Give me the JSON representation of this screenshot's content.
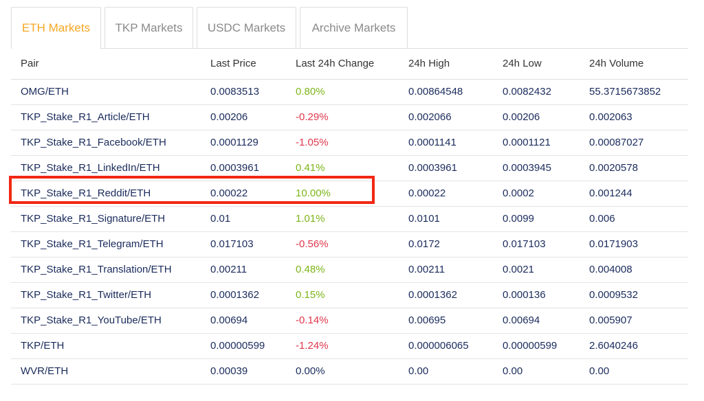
{
  "tabs": [
    {
      "label": "ETH Markets",
      "active": true,
      "width": 131
    },
    {
      "label": "TKP Markets",
      "active": false,
      "width": 129
    },
    {
      "label": "USDC Markets",
      "active": false,
      "width": 145
    },
    {
      "label": "Archive Markets",
      "active": false,
      "width": 157
    }
  ],
  "table": {
    "headers": [
      "Pair",
      "Last Price",
      "Last 24h Change",
      "24h High",
      "24h Low",
      "24h Volume"
    ],
    "rows": [
      {
        "pair": "OMG/ETH",
        "last_price": "0.0083513",
        "change": "0.80%",
        "dir": "pos",
        "high": "0.00864548",
        "low": "0.0082432",
        "volume": "55.3715673852"
      },
      {
        "pair": "TKP_Stake_R1_Article/ETH",
        "last_price": "0.00206",
        "change": "-0.29%",
        "dir": "neg",
        "high": "0.002066",
        "low": "0.00206",
        "volume": "0.002063"
      },
      {
        "pair": "TKP_Stake_R1_Facebook/ETH",
        "last_price": "0.0001129",
        "change": "-1.05%",
        "dir": "neg",
        "high": "0.0001141",
        "low": "0.0001121",
        "volume": "0.00087027"
      },
      {
        "pair": "TKP_Stake_R1_LinkedIn/ETH",
        "last_price": "0.0003961",
        "change": "0.41%",
        "dir": "pos",
        "high": "0.0003961",
        "low": "0.0003945",
        "volume": "0.0020578"
      },
      {
        "pair": "TKP_Stake_R1_Reddit/ETH",
        "last_price": "0.00022",
        "change": "10.00%",
        "dir": "pos",
        "high": "0.00022",
        "low": "0.0002",
        "volume": "0.001244"
      },
      {
        "pair": "TKP_Stake_R1_Signature/ETH",
        "last_price": "0.01",
        "change": "1.01%",
        "dir": "pos",
        "high": "0.0101",
        "low": "0.0099",
        "volume": "0.006"
      },
      {
        "pair": "TKP_Stake_R1_Telegram/ETH",
        "last_price": "0.017103",
        "change": "-0.56%",
        "dir": "neg",
        "high": "0.0172",
        "low": "0.017103",
        "volume": "0.0171903"
      },
      {
        "pair": "TKP_Stake_R1_Translation/ETH",
        "last_price": "0.00211",
        "change": "0.48%",
        "dir": "pos",
        "high": "0.00211",
        "low": "0.0021",
        "volume": "0.004008"
      },
      {
        "pair": "TKP_Stake_R1_Twitter/ETH",
        "last_price": "0.0001362",
        "change": "0.15%",
        "dir": "pos",
        "high": "0.0001362",
        "low": "0.000136",
        "volume": "0.0009532"
      },
      {
        "pair": "TKP_Stake_R1_YouTube/ETH",
        "last_price": "0.00694",
        "change": "-0.14%",
        "dir": "neg",
        "high": "0.00695",
        "low": "0.00694",
        "volume": "0.005907"
      },
      {
        "pair": "TKP/ETH",
        "last_price": "0.00000599",
        "change": "-1.24%",
        "dir": "neg",
        "high": "0.000006065",
        "low": "0.00000599",
        "volume": "2.6040246"
      },
      {
        "pair": "WVR/ETH",
        "last_price": "0.00039",
        "change": "0.00%",
        "dir": "neu",
        "high": "0.00",
        "low": "0.00",
        "volume": "0.00"
      }
    ]
  },
  "colors": {
    "active_tab": "#f5a623",
    "positive": "#7cb518",
    "negative": "#e0364b",
    "text": "#1a2b5c",
    "highlight_box": "#f22713"
  }
}
